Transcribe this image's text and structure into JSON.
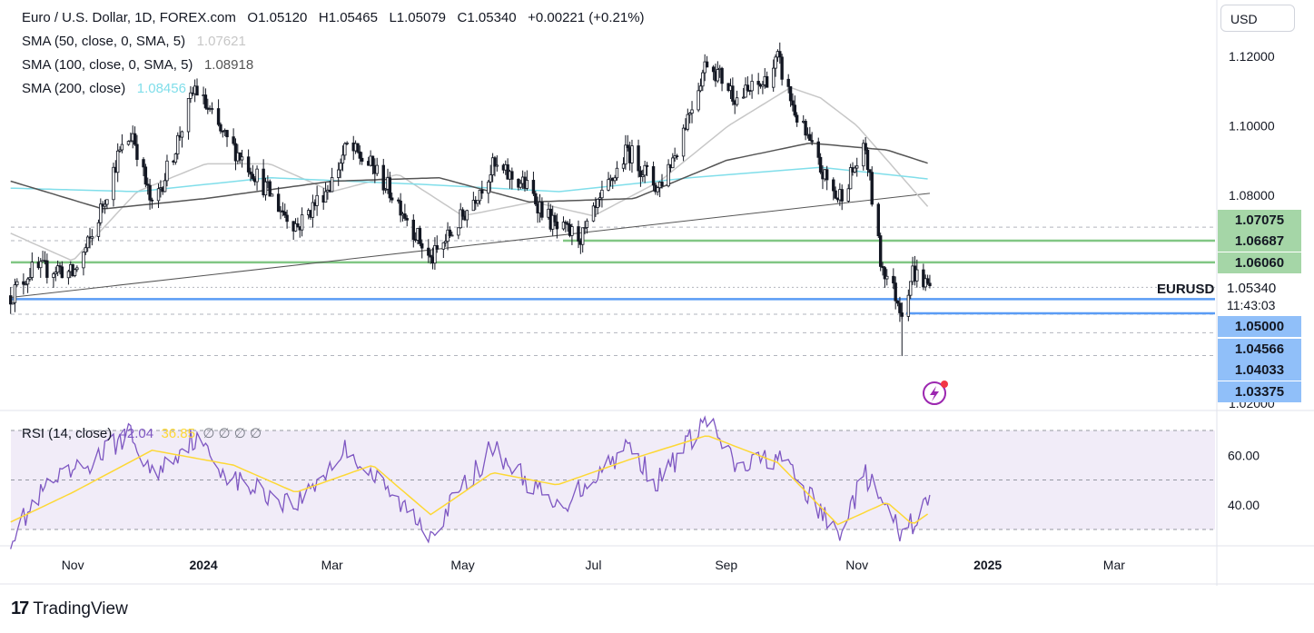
{
  "header": {
    "symbol_title": "Euro / U.S. Dollar, 1D, FOREX.com",
    "ohlc": [
      {
        "k": "O",
        "v": "1.05120"
      },
      {
        "k": "H",
        "v": "1.05465"
      },
      {
        "k": "L",
        "v": "1.05079"
      },
      {
        "k": "C",
        "v": "1.05340"
      }
    ],
    "change": "+0.00221 (+0.21%)",
    "currency": "USD"
  },
  "indicators": {
    "sma50": {
      "label": "SMA (50, close, 0, SMA, 5)",
      "value": "1.07621",
      "color": "#c7c7c7"
    },
    "sma100": {
      "label": "SMA (100, close, 0, SMA, 5)",
      "value": "1.08918",
      "color": "#555555"
    },
    "sma200": {
      "label": "SMA (200, close)",
      "value": "1.08456",
      "color": "#80deea"
    },
    "rsi": {
      "label": "RSI (14, close)",
      "value": "42.04",
      "ma_value": "36.85",
      "extra": "∅ ∅ ∅ ∅"
    }
  },
  "price_axis": {
    "ticks": [
      "1.12000",
      "1.10000",
      "1.08000",
      "1.02000"
    ],
    "tags": [
      {
        "text": "1.07075",
        "kind": "green",
        "price": 1.07075
      },
      {
        "text": "1.06687",
        "kind": "green",
        "price": 1.06687
      },
      {
        "text": "1.06060",
        "kind": "green",
        "price": 1.0606
      },
      {
        "text": "1.05000",
        "kind": "blue",
        "price": 1.05
      },
      {
        "text": "1.04566",
        "kind": "blue",
        "price": 1.04566
      },
      {
        "text": "1.04033",
        "kind": "blue",
        "price": 1.04033
      },
      {
        "text": "1.03375",
        "kind": "blue",
        "price": 1.03375
      }
    ],
    "symbol_label": "EURUSD",
    "last_price": "1.05340",
    "countdown": "11:43:03"
  },
  "rsi_axis": {
    "ticks": [
      "60.00",
      "40.00"
    ]
  },
  "time_axis": {
    "labels": [
      {
        "text": "Nov",
        "bold": false
      },
      {
        "text": "2024",
        "bold": true
      },
      {
        "text": "Mar",
        "bold": false
      },
      {
        "text": "May",
        "bold": false
      },
      {
        "text": "Jul",
        "bold": false
      },
      {
        "text": "Sep",
        "bold": false
      },
      {
        "text": "Nov",
        "bold": false
      },
      {
        "text": "2025",
        "bold": true
      },
      {
        "text": "Mar",
        "bold": false
      }
    ]
  },
  "branding": {
    "name": "TradingView",
    "mark": "17"
  },
  "colors": {
    "bull": "#131722",
    "bear": "#131722",
    "support": "#90bff9",
    "resistance": "#a5d6a7",
    "rsi": "#7e57c2",
    "rsi_ma": "#fdd835"
  },
  "chart_data": {
    "type": "candlestick",
    "title": "Euro / U.S. Dollar, 1D, FOREX.com",
    "ylim": [
      1.02,
      1.125
    ],
    "x_range": [
      "2023-10",
      "2025-03"
    ],
    "horizontal_levels": [
      1.07075,
      1.06687,
      1.0606,
      1.05,
      1.04566,
      1.04033,
      1.03375
    ],
    "trendline": {
      "from": [
        "2023-10-03",
        1.0505
      ],
      "to": [
        "2024-12-05",
        1.0805
      ]
    },
    "close_path": [
      [
        "2023-10-03",
        1.051
      ],
      [
        "2023-10-12",
        1.058
      ],
      [
        "2023-10-25",
        1.059
      ],
      [
        "2023-11-01",
        1.057
      ],
      [
        "2023-11-10",
        1.068
      ],
      [
        "2023-11-22",
        1.091
      ],
      [
        "2023-11-29",
        1.098
      ],
      [
        "2023-12-08",
        1.076
      ],
      [
        "2023-12-18",
        1.092
      ],
      [
        "2023-12-28",
        1.111
      ],
      [
        "2024-01-10",
        1.097
      ],
      [
        "2024-01-23",
        1.088
      ],
      [
        "2024-02-06",
        1.076
      ],
      [
        "2024-02-14",
        1.071
      ],
      [
        "2024-03-01",
        1.084
      ],
      [
        "2024-03-08",
        1.094
      ],
      [
        "2024-03-20",
        1.088
      ],
      [
        "2024-04-02",
        1.077
      ],
      [
        "2024-04-16",
        1.061
      ],
      [
        "2024-04-29",
        1.072
      ],
      [
        "2024-05-15",
        1.088
      ],
      [
        "2024-05-30",
        1.083
      ],
      [
        "2024-06-14",
        1.07
      ],
      [
        "2024-06-26",
        1.068
      ],
      [
        "2024-07-17",
        1.093
      ],
      [
        "2024-07-31",
        1.082
      ],
      [
        "2024-08-08",
        1.092
      ],
      [
        "2024-08-23",
        1.119
      ],
      [
        "2024-09-06",
        1.108
      ],
      [
        "2024-09-18",
        1.112
      ],
      [
        "2024-09-25",
        1.119
      ],
      [
        "2024-10-03",
        1.104
      ],
      [
        "2024-10-16",
        1.086
      ],
      [
        "2024-10-23",
        1.079
      ],
      [
        "2024-11-01",
        1.089
      ],
      [
        "2024-11-05",
        1.093
      ],
      [
        "2024-11-12",
        1.061
      ],
      [
        "2024-11-22",
        1.047
      ],
      [
        "2024-11-27",
        1.058
      ],
      [
        "2024-12-05",
        1.0534
      ]
    ],
    "sma50_path": [
      [
        "2023-10-03",
        1.069
      ],
      [
        "2023-11-01",
        1.061
      ],
      [
        "2023-12-01",
        1.081
      ],
      [
        "2024-01-02",
        1.089
      ],
      [
        "2024-02-01",
        1.089
      ],
      [
        "2024-03-01",
        1.081
      ],
      [
        "2024-04-01",
        1.086
      ],
      [
        "2024-05-01",
        1.074
      ],
      [
        "2024-06-03",
        1.078
      ],
      [
        "2024-07-01",
        1.074
      ],
      [
        "2024-08-01",
        1.084
      ],
      [
        "2024-09-02",
        1.1
      ],
      [
        "2024-10-01",
        1.111
      ],
      [
        "2024-10-15",
        1.108
      ],
      [
        "2024-11-01",
        1.1
      ],
      [
        "2024-12-05",
        1.076
      ]
    ],
    "sma100_path": [
      [
        "2023-10-03",
        1.084
      ],
      [
        "2023-11-15",
        1.076
      ],
      [
        "2024-01-02",
        1.079
      ],
      [
        "2024-03-01",
        1.084
      ],
      [
        "2024-04-20",
        1.085
      ],
      [
        "2024-06-01",
        1.078
      ],
      [
        "2024-07-20",
        1.079
      ],
      [
        "2024-09-01",
        1.09
      ],
      [
        "2024-10-10",
        1.095
      ],
      [
        "2024-11-15",
        1.093
      ],
      [
        "2024-12-05",
        1.089
      ]
    ],
    "sma200_path": [
      [
        "2023-10-03",
        1.082
      ],
      [
        "2023-12-01",
        1.081
      ],
      [
        "2024-02-01",
        1.085
      ],
      [
        "2024-04-15",
        1.083
      ],
      [
        "2024-06-15",
        1.081
      ],
      [
        "2024-08-15",
        1.085
      ],
      [
        "2024-10-15",
        1.088
      ],
      [
        "2024-12-05",
        1.0846
      ]
    ],
    "rsi": {
      "ylim": [
        20,
        80
      ],
      "bands": [
        70,
        50,
        30
      ],
      "path": [
        [
          "2023-10-03",
          27
        ],
        [
          "2023-10-20",
          47
        ],
        [
          "2023-11-08",
          56
        ],
        [
          "2023-11-27",
          69
        ],
        [
          "2023-12-08",
          52
        ],
        [
          "2023-12-27",
          67
        ],
        [
          "2024-01-15",
          50
        ],
        [
          "2024-02-13",
          40
        ],
        [
          "2024-03-08",
          63
        ],
        [
          "2024-03-27",
          45
        ],
        [
          "2024-04-16",
          29
        ],
        [
          "2024-05-15",
          63
        ],
        [
          "2024-06-14",
          38
        ],
        [
          "2024-07-17",
          64
        ],
        [
          "2024-07-31",
          49
        ],
        [
          "2024-08-23",
          75
        ],
        [
          "2024-09-06",
          54
        ],
        [
          "2024-09-25",
          60
        ],
        [
          "2024-10-23",
          28
        ],
        [
          "2024-11-05",
          52
        ],
        [
          "2024-11-22",
          27
        ],
        [
          "2024-12-05",
          42.04
        ]
      ],
      "ma_path": [
        [
          "2023-10-03",
          33
        ],
        [
          "2023-11-01",
          45
        ],
        [
          "2023-12-08",
          62
        ],
        [
          "2024-01-15",
          56
        ],
        [
          "2024-02-13",
          45
        ],
        [
          "2024-03-20",
          56
        ],
        [
          "2024-04-16",
          36
        ],
        [
          "2024-05-15",
          53
        ],
        [
          "2024-06-14",
          48
        ],
        [
          "2024-07-17",
          58
        ],
        [
          "2024-08-23",
          68
        ],
        [
          "2024-09-25",
          57
        ],
        [
          "2024-10-23",
          32
        ],
        [
          "2024-11-15",
          41
        ],
        [
          "2024-11-27",
          32
        ],
        [
          "2024-12-05",
          36.85
        ]
      ]
    }
  }
}
